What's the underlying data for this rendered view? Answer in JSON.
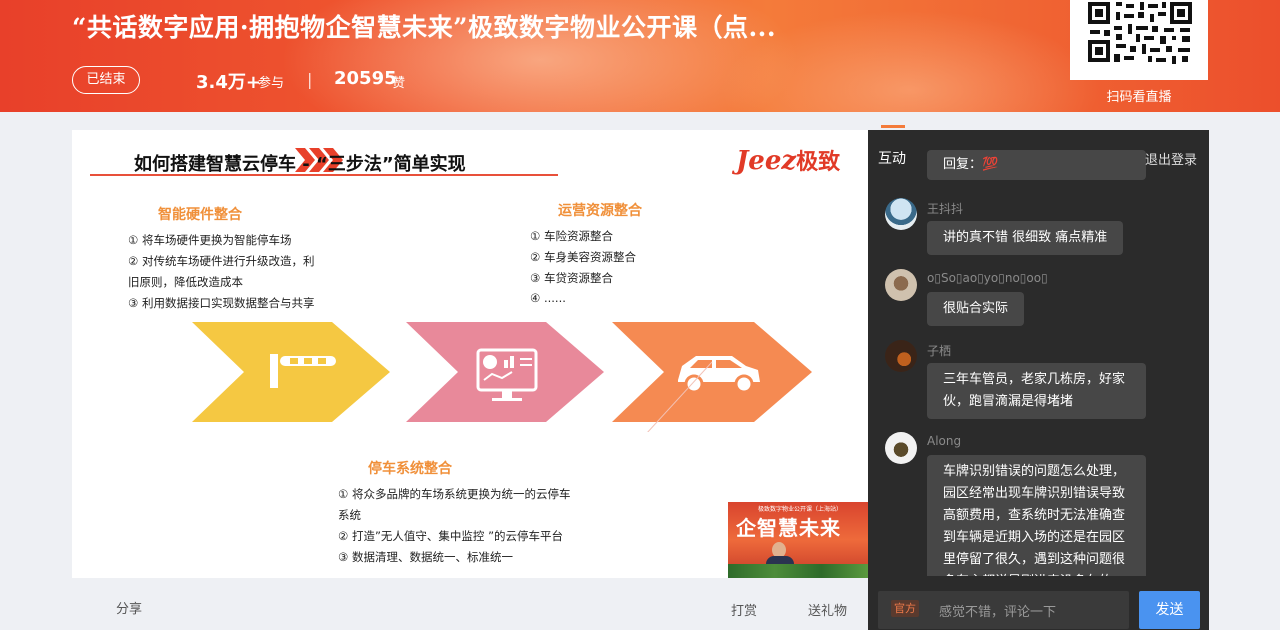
{
  "header": {
    "title": "“共话数字应用·拥抱物企智慧未来”极致数字物业公开课（点...",
    "status": "已结束",
    "participants_value": "3.4万+",
    "participants_label": "参与",
    "separator": "|",
    "likes_value": "20595",
    "likes_label": "赞",
    "qr_label": "扫码看直播"
  },
  "slide": {
    "title": "如何搭建智慧云停车 - “三步法”简单实现",
    "logo_latin": "Jeez",
    "logo_cn": "极致",
    "sections": {
      "hardware": {
        "title": "智能硬件整合",
        "items": [
          "①  将车场硬件更换为智能停车场",
          "②  对传统车场硬件进行升级改造，利",
          "     旧原则，降低改造成本",
          "③  利用数据接口实现数据整合与共享"
        ]
      },
      "operations": {
        "title": "运营资源整合",
        "items": [
          "①  车险资源整合",
          "②  车身美容资源整合",
          "③  车贷资源整合",
          "④  ......"
        ]
      },
      "parking_system": {
        "title": "停车系统整合",
        "items": [
          "①  将众多品牌的车场系统更换为统一的云停车",
          "     系统",
          "②  打造”无人值守、集中监控 ”的云停车平台",
          "③  数据清理、数据统一、标准统一"
        ]
      }
    },
    "arrow_colors": [
      "#f5c842",
      "#e8899a",
      "#f58a52"
    ],
    "video_text": "企智慧未来",
    "video_small_text": "极致数字物业公开课（上海站）"
  },
  "under_bar": {
    "share": "分享",
    "reward": "打赏",
    "gift": "送礼物"
  },
  "chat": {
    "tab": "互动",
    "logout": "退出登录",
    "messages": [
      {
        "user": "",
        "text": "回复：💯"
      },
      {
        "user": "王抖抖",
        "text": "讲的真不错 很细致 痛点精准"
      },
      {
        "user": "o▯So▯ao▯yo▯no▯oo▯",
        "text": "很贴合实际"
      },
      {
        "user": "子栖",
        "text": "三年车管员，老家几栋房，好家伙，跑冒滴漏是得堵堵"
      },
      {
        "user": "Along",
        "text": "车牌识别错误的问题怎么处理，园区经常出现车牌识别错误导致高额费用，查系统时无法准确查到车辆是近期入场的还是在园区里停留了很久，遇到这种问题很多车主都说是刚进来没多久的"
      }
    ],
    "official_badge": "官方",
    "input_placeholder": "感觉不错，评论一下",
    "send_label": "发送"
  }
}
